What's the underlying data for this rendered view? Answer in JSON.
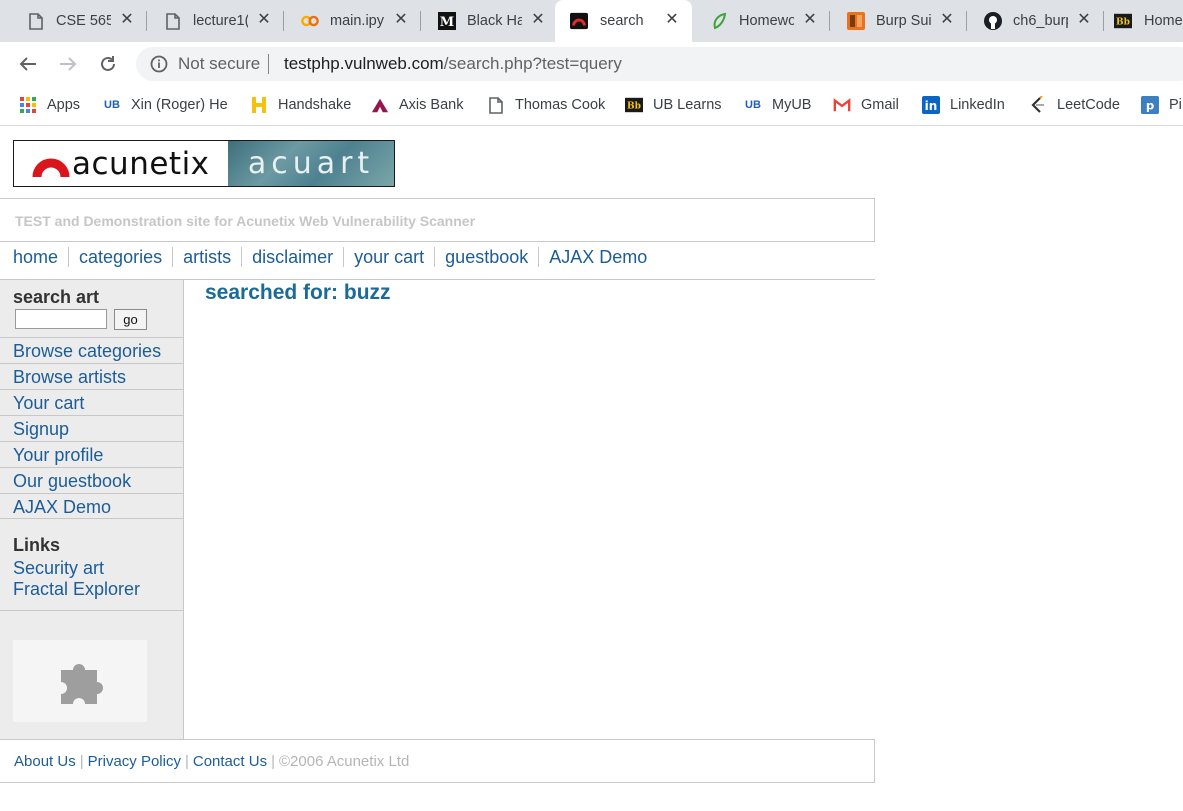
{
  "browser": {
    "tabs": [
      {
        "title": "CSE 565",
        "icon": "document-icon"
      },
      {
        "title": "lecture1(",
        "icon": "document-icon"
      },
      {
        "title": "main.ipy",
        "icon": "colab-icon"
      },
      {
        "title": "Black Ha",
        "icon": "medium-icon"
      },
      {
        "title": "search",
        "icon": "acunetix-icon",
        "active": true
      },
      {
        "title": "Homewo",
        "icon": "leaf-icon"
      },
      {
        "title": "Burp Sui",
        "icon": "burp-icon"
      },
      {
        "title": "ch6_burp",
        "icon": "github-icon"
      },
      {
        "title": "Home",
        "icon": "blackboard-icon"
      }
    ],
    "toolbar": {
      "security_label": "Not secure",
      "url_domain": "testphp.vulnweb.com",
      "url_path": "/search.php?test=query"
    },
    "bookmarks": [
      {
        "label": "Apps",
        "icon": "apps-grid-icon"
      },
      {
        "label": "Xin (Roger) He",
        "icon": "ub-icon"
      },
      {
        "label": "Handshake",
        "icon": "handshake-icon"
      },
      {
        "label": "Axis Bank",
        "icon": "axis-bank-icon"
      },
      {
        "label": "Thomas Cook",
        "icon": "document-icon"
      },
      {
        "label": "UB Learns",
        "icon": "blackboard-icon"
      },
      {
        "label": "MyUB",
        "icon": "ub-icon"
      },
      {
        "label": "Gmail",
        "icon": "gmail-icon"
      },
      {
        "label": "LinkedIn",
        "icon": "linkedin-icon"
      },
      {
        "label": "LeetCode",
        "icon": "leetcode-icon"
      },
      {
        "label": "Pi",
        "icon": "pi-icon"
      }
    ]
  },
  "site": {
    "logo_left": "acunetix",
    "logo_right": "acuart",
    "tagline": "TEST and Demonstration site for Acunetix Web Vulnerability Scanner",
    "nav": [
      "home",
      "categories",
      "artists",
      "disclaimer",
      "your cart",
      "guestbook",
      "AJAX Demo"
    ],
    "sidebar": {
      "search_title": "search art",
      "search_value": "",
      "go_label": "go",
      "menu": [
        "Browse categories",
        "Browse artists",
        "Your cart",
        "Signup",
        "Your profile",
        "Our guestbook",
        "AJAX Demo"
      ],
      "links_title": "Links",
      "links": [
        "Security art",
        "Fractal Explorer"
      ]
    },
    "main_heading": "searched for: buzz",
    "footer": {
      "links": [
        "About Us",
        "Privacy Policy",
        "Contact Us"
      ],
      "copyright": "©2006 Acunetix Ltd"
    }
  },
  "colors": {
    "link": "#1c5d99",
    "heading": "#1c6a99",
    "tabstrip": "#dee1e6",
    "sidebar_bg": "#ececec"
  }
}
